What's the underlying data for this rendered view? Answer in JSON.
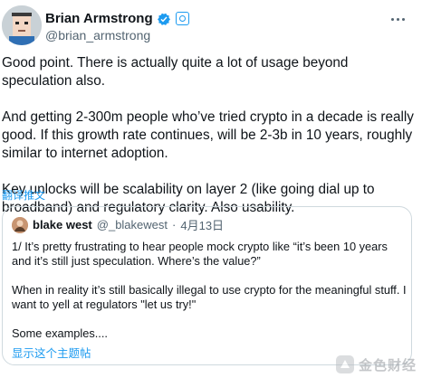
{
  "author": {
    "name": "Brian Armstrong",
    "handle": "@brian_armstrong"
  },
  "tweet": {
    "paragraphs": [
      "Good point. There is actually quite a lot of usage beyond speculation also.",
      "And getting 2-300m people who’ve tried crypto in a decade is really good. If this growth rate continues, will be 2-3b in 10 years, roughly similar to internet adoption.",
      "Key unlocks will be scalability on layer 2 (like going dial up to broadband) and regulatory clarity. Also usability."
    ],
    "translate_label": "翻译推文"
  },
  "quoted": {
    "name": "blake west",
    "handle": "@_blakewest",
    "separator": "·",
    "date": "4月13日",
    "paragraphs": [
      "1/ It’s pretty frustrating to hear people mock crypto like “it’s been 10 years and it’s still just speculation. Where’s the value?”",
      "When in reality it’s still basically illegal to use crypto for the meaningful stuff. I want to yell at regulators \"let us try!\"",
      "Some examples...."
    ],
    "show_thread": "显示这个主题帖"
  },
  "watermark": {
    "text": "金色财经"
  },
  "icons": {
    "verified": "verified-badge-icon",
    "affiliate": "coinbase-affiliate-icon",
    "more": "more-options-icon"
  },
  "colors": {
    "accent": "#1d9bf0",
    "text": "#0f1419",
    "muted": "#536471",
    "border": "#cfd9de"
  }
}
